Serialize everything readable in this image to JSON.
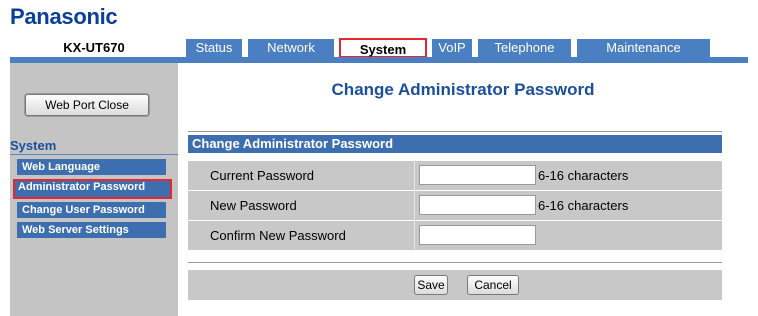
{
  "brand": "Panasonic",
  "model": "KX-UT670",
  "tabs": [
    {
      "label": "Status"
    },
    {
      "label": "Network"
    },
    {
      "label": "System"
    },
    {
      "label": "VoIP"
    },
    {
      "label": "Telephone"
    },
    {
      "label": "Maintenance"
    }
  ],
  "active_tab": "System",
  "sidebar": {
    "web_port_close": "Web Port Close",
    "heading": "System",
    "items": [
      {
        "label": "Web Language"
      },
      {
        "label": "Administrator Password"
      },
      {
        "label": "Change User Password"
      },
      {
        "label": "Web Server Settings"
      }
    ],
    "selected": "Administrator Password"
  },
  "main": {
    "title": "Change Administrator Password",
    "section": "Change Administrator Password",
    "fields": [
      {
        "label": "Current Password",
        "value": "",
        "hint": "6-16 characters"
      },
      {
        "label": "New Password",
        "value": "",
        "hint": "6-16 characters"
      },
      {
        "label": "Confirm New Password",
        "value": "",
        "hint": ""
      }
    ],
    "save_label": "Save",
    "cancel_label": "Cancel"
  },
  "colors": {
    "brand": "#0b3f9a",
    "tab": "#4a7fc1",
    "highlight": "#e5282e",
    "sidebar_bg": "#c4c4c4",
    "section_header": "#3d6fb0"
  }
}
